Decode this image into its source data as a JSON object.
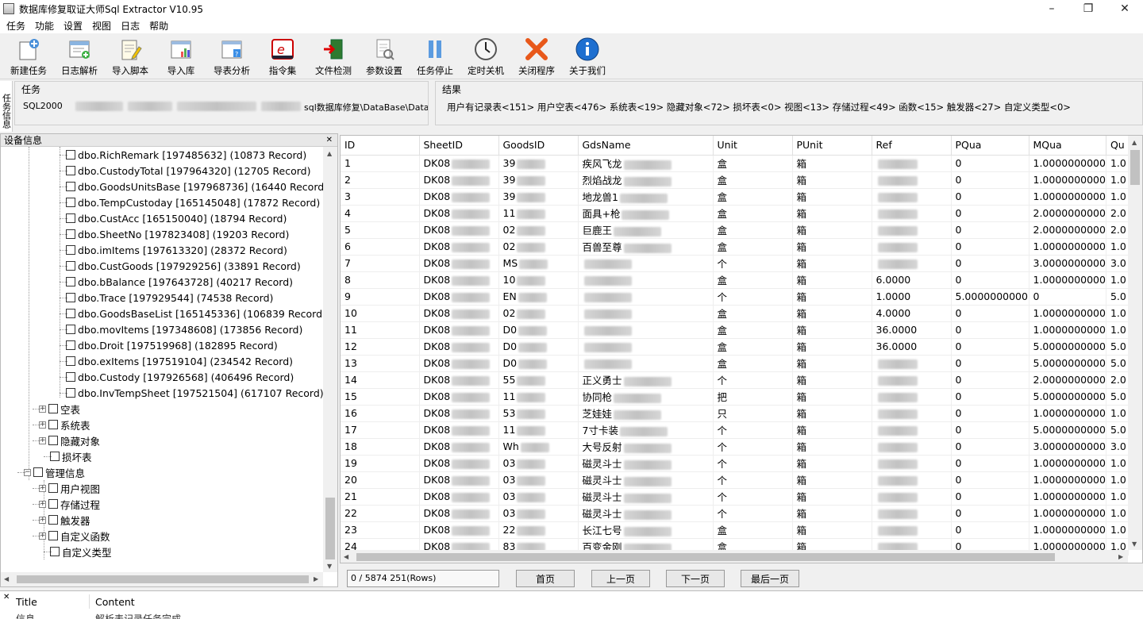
{
  "window": {
    "title": "数据库修复取证大师Sql Extractor V10.95"
  },
  "menu": [
    "任务",
    "功能",
    "设置",
    "视图",
    "日志",
    "帮助"
  ],
  "toolbar": [
    {
      "label": "新建任务",
      "icon": "new-task-icon"
    },
    {
      "label": "日志解析",
      "icon": "log-parse-icon"
    },
    {
      "label": "导入脚本",
      "icon": "import-script-icon"
    },
    {
      "label": "导入库",
      "icon": "import-db-icon"
    },
    {
      "label": "导表分析",
      "icon": "table-analysis-icon"
    },
    {
      "label": "指令集",
      "icon": "command-set-icon"
    },
    {
      "label": "文件检测",
      "icon": "file-check-icon"
    },
    {
      "label": "参数设置",
      "icon": "settings-icon"
    },
    {
      "label": "任务停止",
      "icon": "pause-icon"
    },
    {
      "label": "定时关机",
      "icon": "clock-icon"
    },
    {
      "label": "关闭程序",
      "icon": "close-icon"
    },
    {
      "label": "关于我们",
      "icon": "info-icon"
    }
  ],
  "side_tab": "任务信息",
  "task_panel": {
    "legend": "任务",
    "db_type": "SQL2000",
    "path": "sql数据库修复\\DataBase\\Data"
  },
  "result_panel": {
    "legend": "结果",
    "summary": "用户有记录表<151> 用户空表<476> 系统表<19> 隐藏对象<72> 损坏表<0> 视图<13> 存储过程<49> 函数<15> 触发器<27> 自定义类型<0>"
  },
  "tree": {
    "header": "设备信息",
    "tables": [
      "dbo.RichRemark [197485632] (10873 Record)",
      "dbo.CustodyTotal [197964320] (12705 Record)",
      "dbo.GoodsUnitsBase [197968736] (16440 Record)",
      "dbo.TempCustoday [165145048] (17872 Record)",
      "dbo.CustAcc [165150040] (18794 Record)",
      "dbo.SheetNo [197823408] (19203 Record)",
      "dbo.imItems [197613320] (28372 Record)",
      "dbo.CustGoods [197929256] (33891 Record)",
      "dbo.bBalance [197643728] (40217 Record)",
      "dbo.Trace [197929544] (74538 Record)",
      "dbo.GoodsBaseList [165145336] (106839 Record)",
      "dbo.movItems [197348608] (173856 Record)",
      "dbo.Droit [197519968] (182895 Record)",
      "dbo.exItems [197519104] (234542 Record)",
      "dbo.Custody [197926568] (406496 Record)",
      "dbo.InvTempSheet [197521504] (617107 Record)"
    ],
    "groups": [
      {
        "label": "空表",
        "expandable": true
      },
      {
        "label": "系统表",
        "expandable": true
      },
      {
        "label": "隐藏对象",
        "expandable": true
      },
      {
        "label": "损坏表",
        "expandable": false
      }
    ],
    "management": {
      "label": "管理信息",
      "children": [
        {
          "label": "用户视图",
          "expandable": true
        },
        {
          "label": "存储过程",
          "expandable": true
        },
        {
          "label": "触发器",
          "expandable": true
        },
        {
          "label": "自定义函数",
          "expandable": true
        },
        {
          "label": "自定义类型",
          "expandable": false
        }
      ]
    }
  },
  "grid": {
    "columns": [
      "ID",
      "SheetID",
      "GoodsID",
      "GdsName",
      "Unit",
      "PUnit",
      "Ref",
      "PQua",
      "MQua",
      "Qu"
    ],
    "rows": [
      [
        "1",
        "DK08",
        "39",
        "疾风飞龙",
        "盒",
        "箱",
        "",
        "0",
        "1.0000000000",
        "1.0"
      ],
      [
        "2",
        "DK08",
        "39",
        "烈焰战龙",
        "盒",
        "箱",
        "",
        "0",
        "1.0000000000",
        "1.0"
      ],
      [
        "3",
        "DK08",
        "39",
        "地龙兽1",
        "盒",
        "箱",
        "",
        "0",
        "1.0000000000",
        "1.0"
      ],
      [
        "4",
        "DK08",
        "11",
        "面具+枪",
        "盒",
        "箱",
        "",
        "0",
        "2.0000000000",
        "2.0"
      ],
      [
        "5",
        "DK08",
        "02",
        "巨鹿王",
        "盒",
        "箱",
        "",
        "0",
        "2.0000000000",
        "2.0"
      ],
      [
        "6",
        "DK08",
        "02",
        "百兽至尊",
        "盒",
        "箱",
        "",
        "0",
        "1.0000000000",
        "1.0"
      ],
      [
        "7",
        "DK08",
        "MS",
        "",
        "个",
        "箱",
        "",
        "0",
        "3.0000000000",
        "3.0"
      ],
      [
        "8",
        "DK08",
        "10",
        "",
        "盒",
        "箱",
        "6.0000",
        "0",
        "1.0000000000",
        "1.0"
      ],
      [
        "9",
        "DK08",
        "EN",
        "",
        "个",
        "箱",
        "1.0000",
        "5.0000000000",
        "0",
        "5.0"
      ],
      [
        "10",
        "DK08",
        "02",
        "",
        "盒",
        "箱",
        "4.0000",
        "0",
        "1.0000000000",
        "1.0"
      ],
      [
        "11",
        "DK08",
        "D0",
        "",
        "盒",
        "箱",
        "36.0000",
        "0",
        "1.0000000000",
        "1.0"
      ],
      [
        "12",
        "DK08",
        "D0",
        "",
        "盒",
        "箱",
        "36.0000",
        "0",
        "5.0000000000",
        "5.0"
      ],
      [
        "13",
        "DK08",
        "D0",
        "",
        "盒",
        "箱",
        "",
        "0",
        "5.0000000000",
        "5.0"
      ],
      [
        "14",
        "DK08",
        "55",
        "正义勇士",
        "个",
        "箱",
        "",
        "0",
        "2.0000000000",
        "2.0"
      ],
      [
        "15",
        "DK08",
        "11",
        "协同枪",
        "把",
        "箱",
        "",
        "0",
        "5.0000000000",
        "5.0"
      ],
      [
        "16",
        "DK08",
        "53",
        "芝娃娃",
        "只",
        "箱",
        "",
        "0",
        "1.0000000000",
        "1.0"
      ],
      [
        "17",
        "DK08",
        "11",
        "7寸卡装",
        "个",
        "箱",
        "",
        "0",
        "5.0000000000",
        "5.0"
      ],
      [
        "18",
        "DK08",
        "Wh",
        "大号反射",
        "个",
        "箱",
        "",
        "0",
        "3.0000000000",
        "3.0"
      ],
      [
        "19",
        "DK08",
        "03",
        "磁灵斗士",
        "个",
        "箱",
        "",
        "0",
        "1.0000000000",
        "1.0"
      ],
      [
        "20",
        "DK08",
        "03",
        "磁灵斗士",
        "个",
        "箱",
        "",
        "0",
        "1.0000000000",
        "1.0"
      ],
      [
        "21",
        "DK08",
        "03",
        "磁灵斗士",
        "个",
        "箱",
        "",
        "0",
        "1.0000000000",
        "1.0"
      ],
      [
        "22",
        "DK08",
        "03",
        "磁灵斗士",
        "个",
        "箱",
        "",
        "0",
        "1.0000000000",
        "1.0"
      ],
      [
        "23",
        "DK08",
        "22",
        "长江七号",
        "盒",
        "箱",
        "",
        "0",
        "1.0000000000",
        "1.0"
      ],
      [
        "24",
        "DK08",
        "83",
        "百变金刚",
        "盒",
        "箱",
        "",
        "0",
        "1.0000000000",
        "1.0"
      ]
    ]
  },
  "pager": {
    "status": "0 / 5874  251(Rows)",
    "first": "首页",
    "prev": "上一页",
    "next": "下一页",
    "last": "最后一页"
  },
  "log": {
    "col_title": "Title",
    "col_content": "Content",
    "row_title": "信息",
    "row_content": "解析表记录任务完成"
  }
}
